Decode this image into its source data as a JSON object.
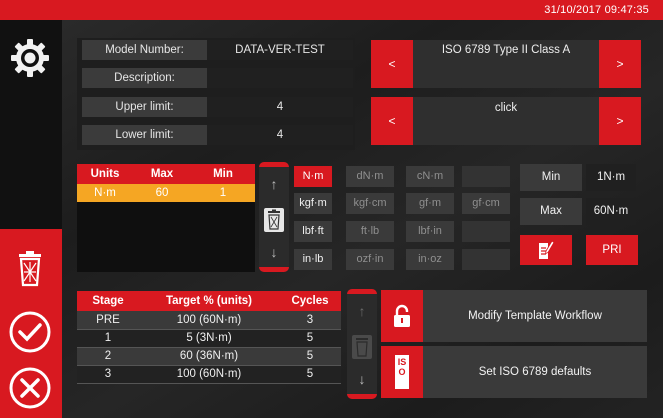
{
  "status_bar": {
    "datetime": "31/10/2017 09:47:35"
  },
  "sidebar": {
    "settings_icon": "gear-icon",
    "delete_icon": "trash-icon",
    "confirm_icon": "check-circle-icon",
    "cancel_icon": "x-circle-icon"
  },
  "fields": {
    "model_number": {
      "label": "Model Number:",
      "value": "DATA-VER-TEST"
    },
    "description": {
      "label": "Description:",
      "value": ""
    },
    "upper_limit": {
      "label": "Upper limit:",
      "value": "4"
    },
    "lower_limit": {
      "label": "Lower limit:",
      "value": "4"
    }
  },
  "standard_selector": {
    "prev": "<",
    "value": "ISO 6789 Type II Class A",
    "next": ">"
  },
  "mode_selector": {
    "prev": "<",
    "value": "click",
    "next": ">"
  },
  "units_table": {
    "headers": [
      "Units",
      "Max",
      "Min"
    ],
    "rows": [
      {
        "units": "N·m",
        "max": "60",
        "min": "1"
      }
    ]
  },
  "units_rail": {
    "up": "↑",
    "delete_icon": "trash-icon",
    "down": "↓"
  },
  "unit_grid": [
    [
      "N·m",
      "dN·m",
      "cN·m",
      ""
    ],
    [
      "kgf·m",
      "kgf·cm",
      "gf·m",
      "gf·cm"
    ],
    [
      "lbf·ft",
      "ft·lb",
      "lbf·in",
      ""
    ],
    [
      "in·lb",
      "ozf·in",
      "in·oz",
      ""
    ]
  ],
  "minmax": {
    "min_label": "Min",
    "min_value": "1N·m",
    "max_label": "Max",
    "max_value": "60N·m"
  },
  "actions": {
    "edit_icon": "edit-document-icon",
    "pri_label": "PRI"
  },
  "stage_table": {
    "headers": [
      "Stage",
      "Target % (units)",
      "Cycles"
    ],
    "rows": [
      {
        "stage": "PRE",
        "target": "100 (60N·m)",
        "cycles": "3"
      },
      {
        "stage": "1",
        "target": "5 (3N·m)",
        "cycles": "5"
      },
      {
        "stage": "2",
        "target": "60 (36N·m)",
        "cycles": "5"
      },
      {
        "stage": "3",
        "target": "100 (60N·m)",
        "cycles": "5"
      }
    ]
  },
  "stage_rail": {
    "up": "↑",
    "delete_icon": "trash-icon",
    "down": "↓"
  },
  "workflow": {
    "modify_label": "Modify Template Workflow",
    "modify_icon": "unlock-icon",
    "iso_label": "Set ISO 6789 defaults",
    "iso_icon": "iso-icon",
    "iso_icon_text": "ISO"
  },
  "colors": {
    "accent": "#d81920",
    "selected_row": "#f5a623",
    "panel": "#3a3a3a"
  }
}
